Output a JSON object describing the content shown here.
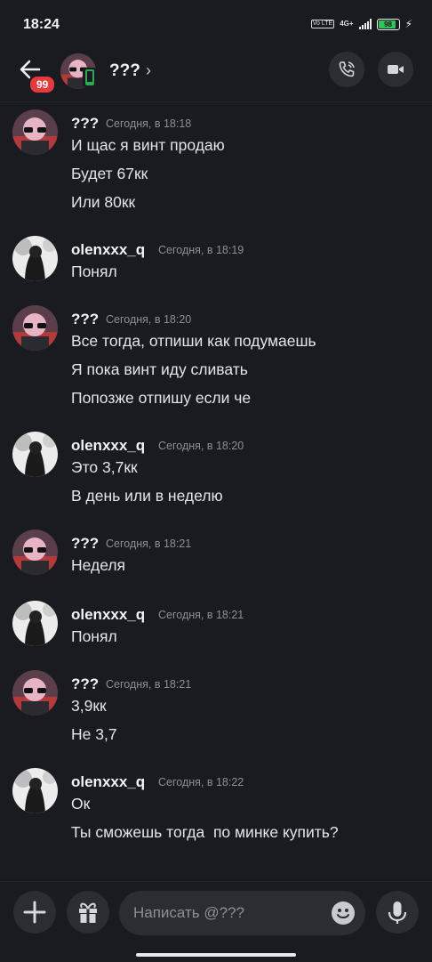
{
  "status_bar": {
    "time": "18:24",
    "volte": "Vo LTE",
    "network": "4G+",
    "battery": "98",
    "battery_level": 0.98
  },
  "header": {
    "unread_badge": "99",
    "title": "???",
    "chevron": "›",
    "call_icon": "phone-call-icon",
    "video_icon": "video-camera-icon"
  },
  "messages": [
    {
      "author": "???",
      "time": "Сегодня, в 18:18",
      "lines": [
        "И щас я винт продаю",
        "Будет 67кк",
        "Или 80кк"
      ]
    },
    {
      "author": "olenxxx_q",
      "time": "Сегодня, в 18:19",
      "lines": [
        "Понял"
      ]
    },
    {
      "author": "???",
      "time": "Сегодня, в 18:20",
      "lines": [
        "Все тогда, отпиши как подумаешь",
        "Я пока винт иду сливать",
        "Попозже отпишу если че"
      ]
    },
    {
      "author": "olenxxx_q",
      "time": "Сегодня, в 18:20",
      "lines": [
        "Это 3,7кк",
        "В день или в неделю"
      ]
    },
    {
      "author": "???",
      "time": "Сегодня, в 18:21",
      "lines": [
        "Неделя"
      ]
    },
    {
      "author": "olenxxx_q",
      "time": "Сегодня, в 18:21",
      "lines": [
        "Понял"
      ]
    },
    {
      "author": "???",
      "time": "Сегодня, в 18:21",
      "lines": [
        "3,9кк",
        "Не 3,7"
      ]
    },
    {
      "author": "olenxxx_q",
      "time": "Сегодня, в 18:22",
      "lines": [
        "Ок",
        "Ты сможешь тогда  по минке купить?"
      ]
    }
  ],
  "composer": {
    "placeholder": "Написать @???",
    "add_icon": "plus-icon",
    "gift_icon": "gift-icon",
    "emoji_icon": "emoji-icon",
    "mic_icon": "microphone-icon"
  }
}
